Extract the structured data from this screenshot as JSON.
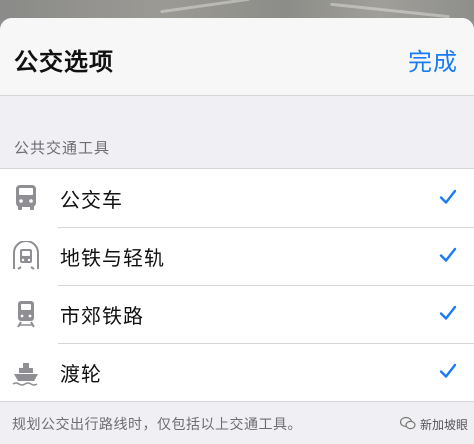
{
  "header": {
    "title": "公交选项",
    "done_label": "完成"
  },
  "section": {
    "title": "公共交通工具"
  },
  "items": [
    {
      "label": "公交车",
      "icon": "bus-icon",
      "checked": true
    },
    {
      "label": "地铁与轻轨",
      "icon": "subway-icon",
      "checked": true
    },
    {
      "label": "市郊铁路",
      "icon": "train-icon",
      "checked": true
    },
    {
      "label": "渡轮",
      "icon": "ferry-icon",
      "checked": true
    }
  ],
  "footer": {
    "note": "规划公交出行路线时，仅包括以上交通工具。",
    "watermark": "新加坡眼"
  },
  "colors": {
    "accent": "#1a7cf5",
    "icon_gray": "#8e8e93",
    "background": "#efeff4"
  }
}
